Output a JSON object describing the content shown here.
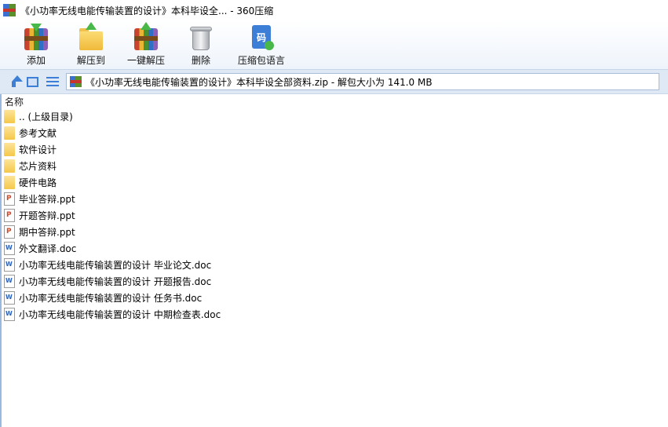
{
  "window": {
    "title": "《小功率无线电能传输装置的设计》本科毕设全... - 360压缩"
  },
  "toolbar": {
    "buttons": [
      {
        "label": "添加",
        "icon": "add-archive-icon"
      },
      {
        "label": "解压到",
        "icon": "extract-to-icon"
      },
      {
        "label": "一键解压",
        "icon": "one-click-extract-icon"
      },
      {
        "label": "删除",
        "icon": "trash-icon"
      },
      {
        "label": "压缩包语言",
        "icon": "archive-language-icon"
      }
    ],
    "language_glyph": "码"
  },
  "address": {
    "path": "《小功率无线电能传输装置的设计》本科毕设全部资料.zip - 解包大小为 141.0 MB"
  },
  "file_list": {
    "column_name": "名称",
    "items": [
      {
        "name": ".. (上级目录)",
        "type": "folder"
      },
      {
        "name": "参考文献",
        "type": "folder"
      },
      {
        "name": "软件设计",
        "type": "folder"
      },
      {
        "name": "芯片资料",
        "type": "folder"
      },
      {
        "name": "硬件电路",
        "type": "folder"
      },
      {
        "name": "毕业答辩.ppt",
        "type": "ppt"
      },
      {
        "name": "开题答辩.ppt",
        "type": "ppt"
      },
      {
        "name": "期中答辩.ppt",
        "type": "ppt"
      },
      {
        "name": "外文翻译.doc",
        "type": "doc"
      },
      {
        "name": "小功率无线电能传输装置的设计 毕业论文.doc",
        "type": "doc"
      },
      {
        "name": "小功率无线电能传输装置的设计 开题报告.doc",
        "type": "doc"
      },
      {
        "name": "小功率无线电能传输装置的设计 任务书.doc",
        "type": "doc"
      },
      {
        "name": "小功率无线电能传输装置的设计 中期检查表.doc",
        "type": "doc"
      }
    ]
  },
  "colors": {
    "accent": "#3d7fd6",
    "folder": "#f5c84a",
    "address_bg": "#dfe9f6"
  }
}
